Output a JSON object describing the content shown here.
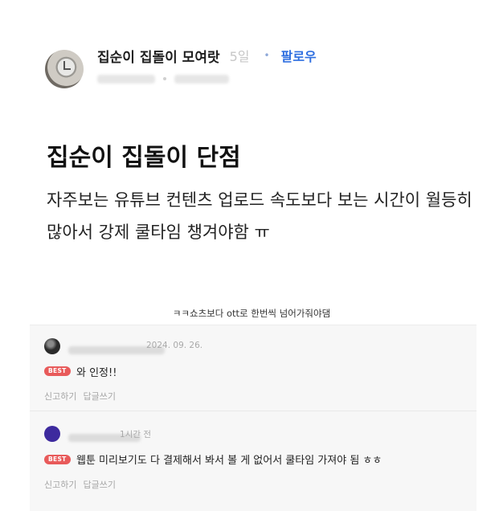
{
  "post": {
    "group_name": "집순이 집돌이 모여랏",
    "time_ago": "5일",
    "separator": "•",
    "follow_label": "팔로우",
    "title": "집순이 집돌이 단점",
    "body": "자주보는 유튜브 컨텐츠 업로드 속도보다 보는 시간이 월등히 많아서 강제 쿨타임 챙겨야함 ㅠ"
  },
  "caption": "ㅋㅋ쇼츠보다 ott로 한번씩 넘어가줘야댐",
  "comments": [
    {
      "date": "2024. 09. 26.",
      "badge": "BEST",
      "text": "와 인정!!",
      "report_label": "신고하기",
      "reply_label": "답글쓰기",
      "avatar_color": "#3a3a3a"
    },
    {
      "date": "1시간 전",
      "badge": "BEST",
      "text": "웹툰 미리보기도 다 결제해서 봐서 볼 게 없어서 쿨타임 가져야 됨 ㅎㅎ",
      "report_label": "신고하기",
      "reply_label": "답글쓰기",
      "avatar_color": "#3d2a9e"
    }
  ],
  "colors": {
    "follow": "#2f6fe0",
    "best_badge": "#e85a5a",
    "comment_bg": "#f7f7f7"
  },
  "icons": {
    "profile": "alarm-clock-avatar"
  }
}
